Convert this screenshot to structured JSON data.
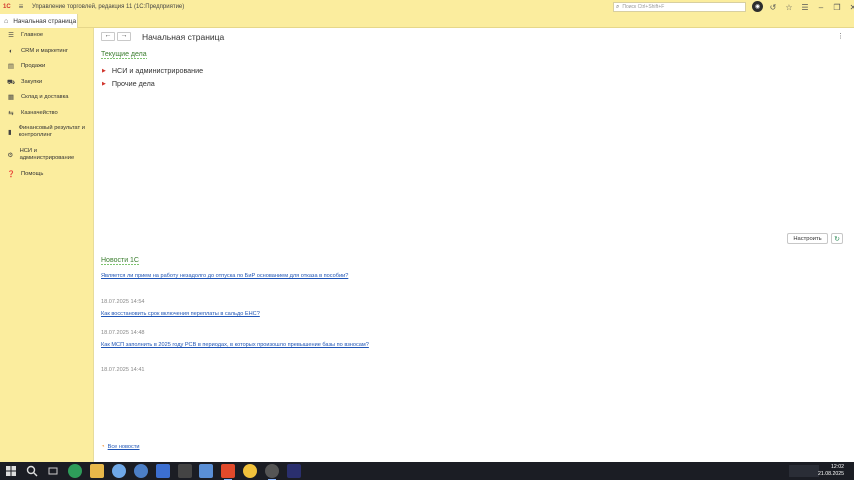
{
  "window": {
    "title": "Управление торговлей, редакция 11  (1С:Предприятие)",
    "logo_text": "1C",
    "search_placeholder": "Поиск Ctrl+Shift+F"
  },
  "tabs": [
    {
      "label": "Начальная страница"
    }
  ],
  "sidebar": {
    "items": [
      {
        "label": "Главное",
        "icon": "menu-lines-icon"
      },
      {
        "label": "CRM и маркетинг",
        "icon": "crm-icon"
      },
      {
        "label": "Продажи",
        "icon": "sales-icon"
      },
      {
        "label": "Закупки",
        "icon": "cart-icon"
      },
      {
        "label": "Склад и доставка",
        "icon": "warehouse-icon"
      },
      {
        "label": "Казначейство",
        "icon": "treasury-icon"
      },
      {
        "label": "Финансовый результат и контроллинг",
        "icon": "chart-icon"
      },
      {
        "label": "НСИ и администрирование",
        "icon": "gear-icon"
      },
      {
        "label": "Помощь",
        "icon": "help-icon"
      }
    ]
  },
  "main": {
    "page_title": "Начальная страница",
    "current_tasks": {
      "title": "Текущие дела",
      "items": [
        "НСИ и администрирование",
        "Прочие дела"
      ]
    },
    "buttons": {
      "settings": "Настроить"
    },
    "news": {
      "title": "Новости 1С",
      "items": [
        {
          "link": "Является ли прием на работу незадолго до отпуска по БиР основанием для отказа в пособии?",
          "date": "18.07.2025 14:54"
        },
        {
          "link": "Как восстановить срок включения переплаты в сальдо ЕНС?",
          "date": "18.07.2025 14:48"
        },
        {
          "link": "Как МСП заполнить в 2025 году РСВ в периодах, в которых произошло превышение базы по взносам?",
          "date": "18.07.2025 14:41"
        }
      ],
      "all_news": "Все новости"
    }
  },
  "taskbar": {
    "time": "12:02",
    "date": "21.08.2025"
  },
  "colors": {
    "panel": "#fbed9e",
    "section_title": "#3a7d2e",
    "link": "#1f55b6",
    "accent_red": "#d0342c"
  }
}
